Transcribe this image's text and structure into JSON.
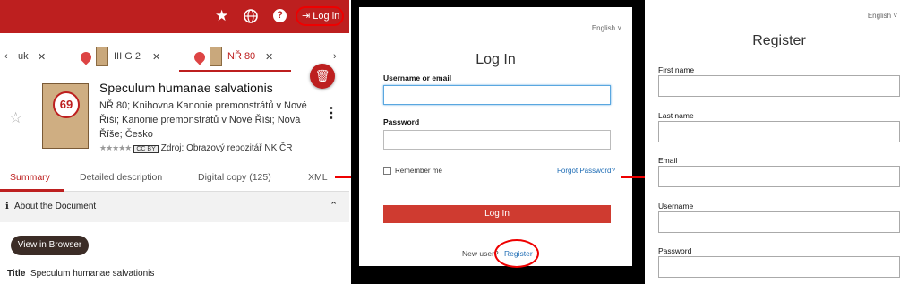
{
  "panel1": {
    "login_label": "Log in",
    "tabs": [
      {
        "label": "uk"
      },
      {
        "label": "III G 2"
      },
      {
        "label": "NŘ 80"
      }
    ],
    "document": {
      "title": "Speculum humanae salvationis",
      "subtitle": "NŘ 80; Knihovna Kanonie premonstrátů v Nové Říši; Kanonie premonstrátů v Nové Říši; Nová Říše; Česko",
      "source": "Zdroj: Obrazový repozitář NK ČR",
      "license": "CC BY",
      "badge": "69"
    },
    "detail_tabs": [
      "Summary",
      "Detailed description",
      "Digital copy (125)",
      "XML"
    ],
    "about_label": "About the Document",
    "view_button": "View in Browser",
    "title_key": "Title",
    "title_value": "Speculum humanae salvationis"
  },
  "panel2": {
    "language": "English",
    "title": "Log In",
    "username_label": "Username or email",
    "password_label": "Password",
    "remember_label": "Remember me",
    "forgot_label": "Forgot Password?",
    "login_button": "Log In",
    "new_user_label": "New user?",
    "register_link": "Register"
  },
  "panel3": {
    "language": "English",
    "title": "Register",
    "fields": [
      "First name",
      "Last name",
      "Email",
      "Username",
      "Password"
    ]
  },
  "colors": {
    "brand_red": "#bd1f1f",
    "annotation_red": "#e00",
    "link_blue": "#1f6db5"
  }
}
